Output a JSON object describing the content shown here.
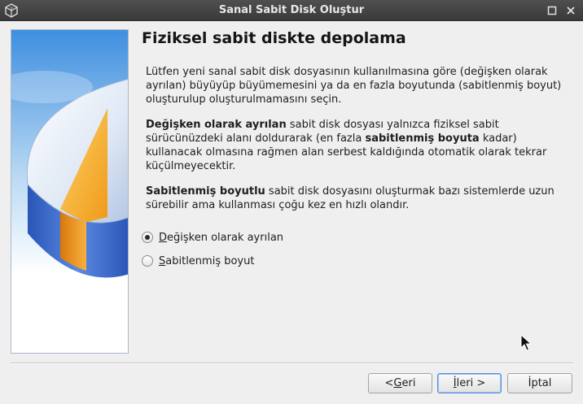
{
  "window": {
    "title": "Sanal Sabit Disk Oluştur"
  },
  "page": {
    "heading": "Fiziksel sabit diskte depolama",
    "intro": "Lütfen yeni sanal sabit disk dosyasının kullanılmasına göre (değişken olarak ayrılan) büyüyüp büyümemesini ya da en fazla boyutunda (sabitlenmiş boyut) oluşturulup oluşturulmamasını seçin.",
    "dynamic_desc": {
      "bold_lead": "Değişken olarak ayrılan",
      "text_a": " sabit disk dosyası yalnızca fiziksel sabit sürücünüzdeki alanı doldurarak (en fazla ",
      "bold_mid": "sabitlenmiş boyuta",
      "text_b": " kadar) kullanacak olmasına rağmen alan serbest kaldığında otomatik olarak tekrar küçülmeyecektir."
    },
    "fixed_desc": {
      "bold_lead": "Sabitlenmiş boyutlu",
      "text": " sabit disk dosyasını oluşturmak bazı sistemlerde uzun sürebilir ama kullanması çoğu kez en hızlı olandır."
    },
    "options": [
      {
        "mnemonic": "D",
        "rest": "eğişken olarak ayrılan",
        "selected": true
      },
      {
        "mnemonic": "S",
        "rest": "abitlenmiş boyut",
        "selected": false
      }
    ]
  },
  "buttons": {
    "back_prefix": "< ",
    "back_mnemonic": "G",
    "back_rest": "eri",
    "next_mnemonic": "İ",
    "next_rest": "leri >",
    "cancel": "İptal"
  },
  "colors": {
    "titlebar": "#3f3f3f",
    "dialog_bg": "#efefef",
    "disk_blue": "#3d6fd0",
    "disk_orange": "#f5a21d"
  },
  "icons": {
    "app": "virtualbox-icon",
    "maximize": "maximize-icon",
    "close": "close-icon",
    "illustration": "hard-disk-pie-illustration",
    "cursor": "mouse-pointer-icon"
  }
}
